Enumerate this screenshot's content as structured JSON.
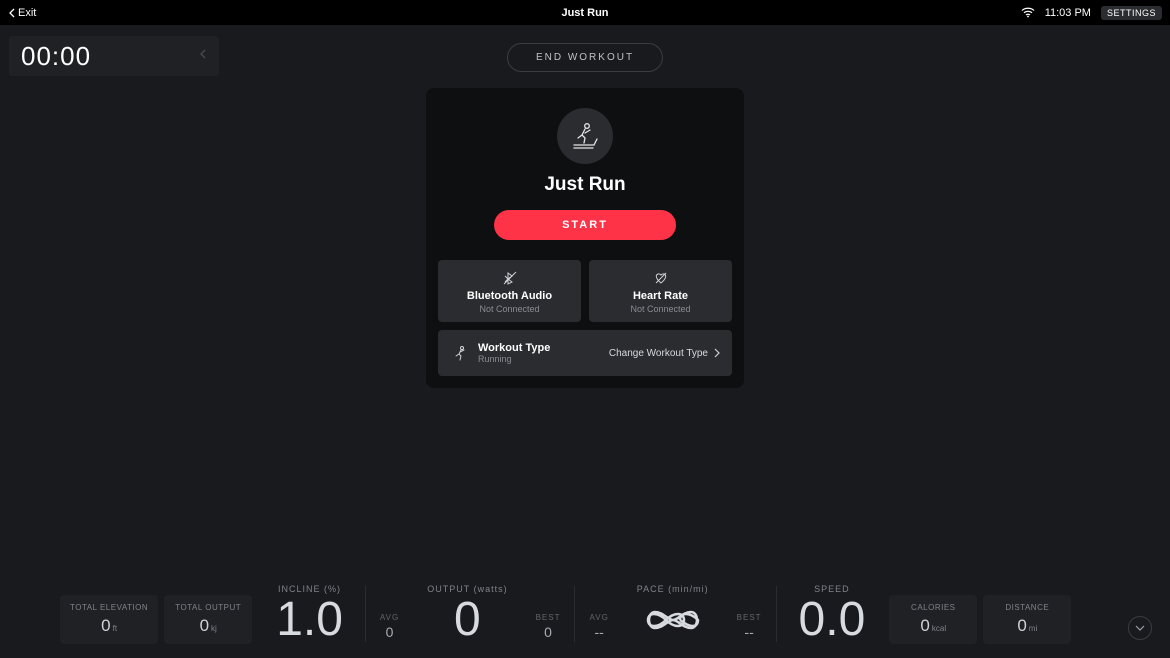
{
  "topbar": {
    "exit_label": "Exit",
    "title": "Just Run",
    "time": "11:03 PM",
    "settings_label": "SETTINGS"
  },
  "timer": {
    "elapsed": "00:00"
  },
  "end_workout_label": "END WORKOUT",
  "card": {
    "title": "Just Run",
    "start_label": "START",
    "bluetooth": {
      "label": "Bluetooth Audio",
      "status": "Not Connected"
    },
    "heartrate": {
      "label": "Heart Rate",
      "status": "Not Connected"
    },
    "workout_type": {
      "label": "Workout Type",
      "value": "Running",
      "action": "Change Workout Type"
    }
  },
  "metrics": {
    "total_elevation": {
      "label": "TOTAL ELEVATION",
      "value": "0",
      "unit": "ft"
    },
    "total_output": {
      "label": "TOTAL OUTPUT",
      "value": "0",
      "unit": "kj"
    },
    "incline": {
      "label": "INCLINE (%)",
      "value": "1.0"
    },
    "output": {
      "label": "OUTPUT (watts)",
      "value": "0"
    },
    "output_avg": {
      "label": "AVG",
      "value": "0"
    },
    "output_best": {
      "label": "BEST",
      "value": "0"
    },
    "pace": {
      "label": "PACE (min/mi)",
      "value": "∞"
    },
    "pace_avg": {
      "label": "AVG",
      "value": "--"
    },
    "pace_best": {
      "label": "BEST",
      "value": "--"
    },
    "speed": {
      "label": "SPEED",
      "value": "0.0"
    },
    "calories": {
      "label": "CALORIES",
      "value": "0",
      "unit": "kcal"
    },
    "distance": {
      "label": "DISTANCE",
      "value": "0",
      "unit": "mi"
    }
  },
  "colors": {
    "accent": "#ff3347",
    "bg": "#181a1d",
    "card": "#0e0f11",
    "tile": "#2a2c30"
  }
}
